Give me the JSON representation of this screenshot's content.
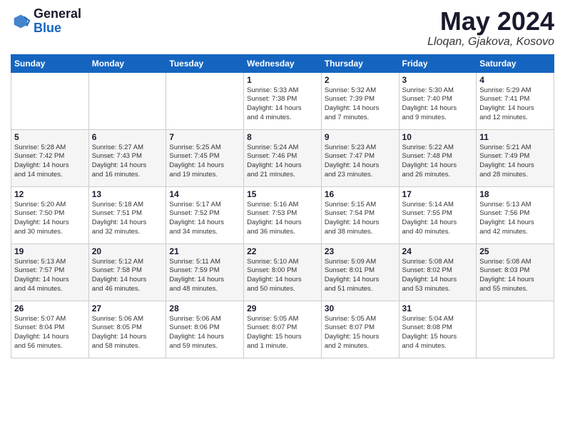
{
  "header": {
    "logo_general": "General",
    "logo_blue": "Blue",
    "month_title": "May 2024",
    "location": "Lloqan, Gjakova, Kosovo"
  },
  "days_of_week": [
    "Sunday",
    "Monday",
    "Tuesday",
    "Wednesday",
    "Thursday",
    "Friday",
    "Saturday"
  ],
  "weeks": [
    {
      "row": 1,
      "days": [
        {
          "num": "",
          "content": ""
        },
        {
          "num": "",
          "content": ""
        },
        {
          "num": "",
          "content": ""
        },
        {
          "num": "1",
          "content": "Sunrise: 5:33 AM\nSunset: 7:38 PM\nDaylight: 14 hours\nand 4 minutes."
        },
        {
          "num": "2",
          "content": "Sunrise: 5:32 AM\nSunset: 7:39 PM\nDaylight: 14 hours\nand 7 minutes."
        },
        {
          "num": "3",
          "content": "Sunrise: 5:30 AM\nSunset: 7:40 PM\nDaylight: 14 hours\nand 9 minutes."
        },
        {
          "num": "4",
          "content": "Sunrise: 5:29 AM\nSunset: 7:41 PM\nDaylight: 14 hours\nand 12 minutes."
        }
      ]
    },
    {
      "row": 2,
      "days": [
        {
          "num": "5",
          "content": "Sunrise: 5:28 AM\nSunset: 7:42 PM\nDaylight: 14 hours\nand 14 minutes."
        },
        {
          "num": "6",
          "content": "Sunrise: 5:27 AM\nSunset: 7:43 PM\nDaylight: 14 hours\nand 16 minutes."
        },
        {
          "num": "7",
          "content": "Sunrise: 5:25 AM\nSunset: 7:45 PM\nDaylight: 14 hours\nand 19 minutes."
        },
        {
          "num": "8",
          "content": "Sunrise: 5:24 AM\nSunset: 7:46 PM\nDaylight: 14 hours\nand 21 minutes."
        },
        {
          "num": "9",
          "content": "Sunrise: 5:23 AM\nSunset: 7:47 PM\nDaylight: 14 hours\nand 23 minutes."
        },
        {
          "num": "10",
          "content": "Sunrise: 5:22 AM\nSunset: 7:48 PM\nDaylight: 14 hours\nand 26 minutes."
        },
        {
          "num": "11",
          "content": "Sunrise: 5:21 AM\nSunset: 7:49 PM\nDaylight: 14 hours\nand 28 minutes."
        }
      ]
    },
    {
      "row": 3,
      "days": [
        {
          "num": "12",
          "content": "Sunrise: 5:20 AM\nSunset: 7:50 PM\nDaylight: 14 hours\nand 30 minutes."
        },
        {
          "num": "13",
          "content": "Sunrise: 5:18 AM\nSunset: 7:51 PM\nDaylight: 14 hours\nand 32 minutes."
        },
        {
          "num": "14",
          "content": "Sunrise: 5:17 AM\nSunset: 7:52 PM\nDaylight: 14 hours\nand 34 minutes."
        },
        {
          "num": "15",
          "content": "Sunrise: 5:16 AM\nSunset: 7:53 PM\nDaylight: 14 hours\nand 36 minutes."
        },
        {
          "num": "16",
          "content": "Sunrise: 5:15 AM\nSunset: 7:54 PM\nDaylight: 14 hours\nand 38 minutes."
        },
        {
          "num": "17",
          "content": "Sunrise: 5:14 AM\nSunset: 7:55 PM\nDaylight: 14 hours\nand 40 minutes."
        },
        {
          "num": "18",
          "content": "Sunrise: 5:13 AM\nSunset: 7:56 PM\nDaylight: 14 hours\nand 42 minutes."
        }
      ]
    },
    {
      "row": 4,
      "days": [
        {
          "num": "19",
          "content": "Sunrise: 5:13 AM\nSunset: 7:57 PM\nDaylight: 14 hours\nand 44 minutes."
        },
        {
          "num": "20",
          "content": "Sunrise: 5:12 AM\nSunset: 7:58 PM\nDaylight: 14 hours\nand 46 minutes."
        },
        {
          "num": "21",
          "content": "Sunrise: 5:11 AM\nSunset: 7:59 PM\nDaylight: 14 hours\nand 48 minutes."
        },
        {
          "num": "22",
          "content": "Sunrise: 5:10 AM\nSunset: 8:00 PM\nDaylight: 14 hours\nand 50 minutes."
        },
        {
          "num": "23",
          "content": "Sunrise: 5:09 AM\nSunset: 8:01 PM\nDaylight: 14 hours\nand 51 minutes."
        },
        {
          "num": "24",
          "content": "Sunrise: 5:08 AM\nSunset: 8:02 PM\nDaylight: 14 hours\nand 53 minutes."
        },
        {
          "num": "25",
          "content": "Sunrise: 5:08 AM\nSunset: 8:03 PM\nDaylight: 14 hours\nand 55 minutes."
        }
      ]
    },
    {
      "row": 5,
      "days": [
        {
          "num": "26",
          "content": "Sunrise: 5:07 AM\nSunset: 8:04 PM\nDaylight: 14 hours\nand 56 minutes."
        },
        {
          "num": "27",
          "content": "Sunrise: 5:06 AM\nSunset: 8:05 PM\nDaylight: 14 hours\nand 58 minutes."
        },
        {
          "num": "28",
          "content": "Sunrise: 5:06 AM\nSunset: 8:06 PM\nDaylight: 14 hours\nand 59 minutes."
        },
        {
          "num": "29",
          "content": "Sunrise: 5:05 AM\nSunset: 8:07 PM\nDaylight: 15 hours\nand 1 minute."
        },
        {
          "num": "30",
          "content": "Sunrise: 5:05 AM\nSunset: 8:07 PM\nDaylight: 15 hours\nand 2 minutes."
        },
        {
          "num": "31",
          "content": "Sunrise: 5:04 AM\nSunset: 8:08 PM\nDaylight: 15 hours\nand 4 minutes."
        },
        {
          "num": "",
          "content": ""
        }
      ]
    }
  ]
}
